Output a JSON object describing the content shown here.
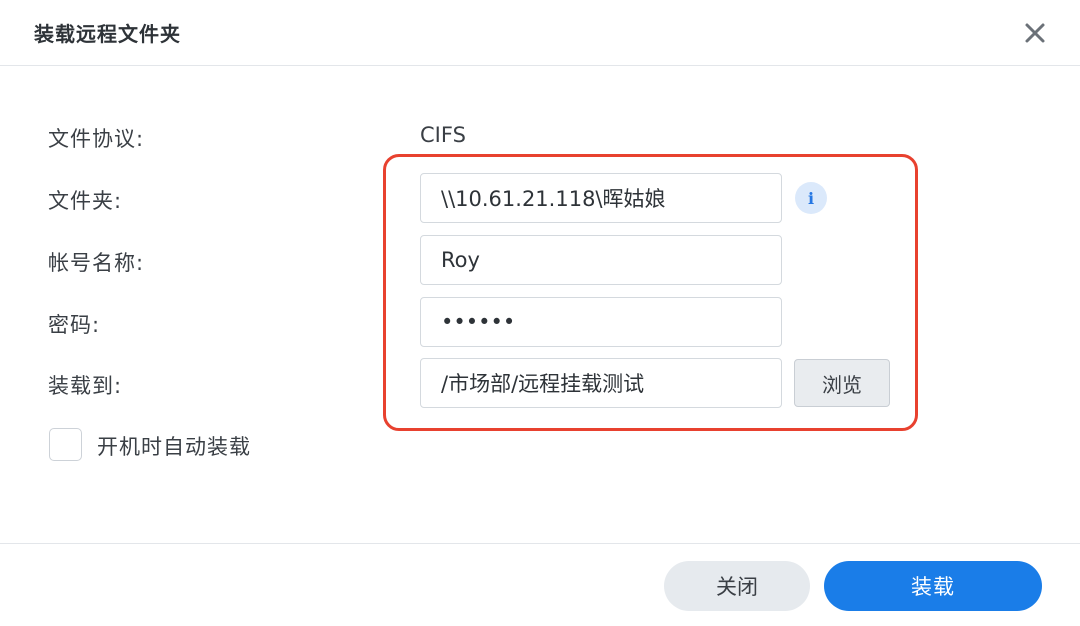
{
  "dialog": {
    "title": "装载远程文件夹"
  },
  "form": {
    "protocol": {
      "label": "文件协议:",
      "value": "CIFS"
    },
    "folder": {
      "label": "文件夹:",
      "value": "\\\\10.61.21.118\\晖姑娘"
    },
    "account": {
      "label": "帐号名称:",
      "value": "Roy"
    },
    "password": {
      "label": "密码:",
      "value": "••••••"
    },
    "mount_to": {
      "label": "装载到:",
      "value": "/市场部/远程挂载测试",
      "browse_label": "浏览"
    },
    "auto_mount": {
      "label": "开机时自动装载",
      "checked": false
    }
  },
  "footer": {
    "cancel_label": "关闭",
    "mount_label": "装载"
  },
  "colors": {
    "accent": "#1a7de8",
    "highlight": "#e8412f",
    "info_bg": "#dbe9fb"
  },
  "icons": {
    "close": "close-icon",
    "info": "info-icon"
  }
}
